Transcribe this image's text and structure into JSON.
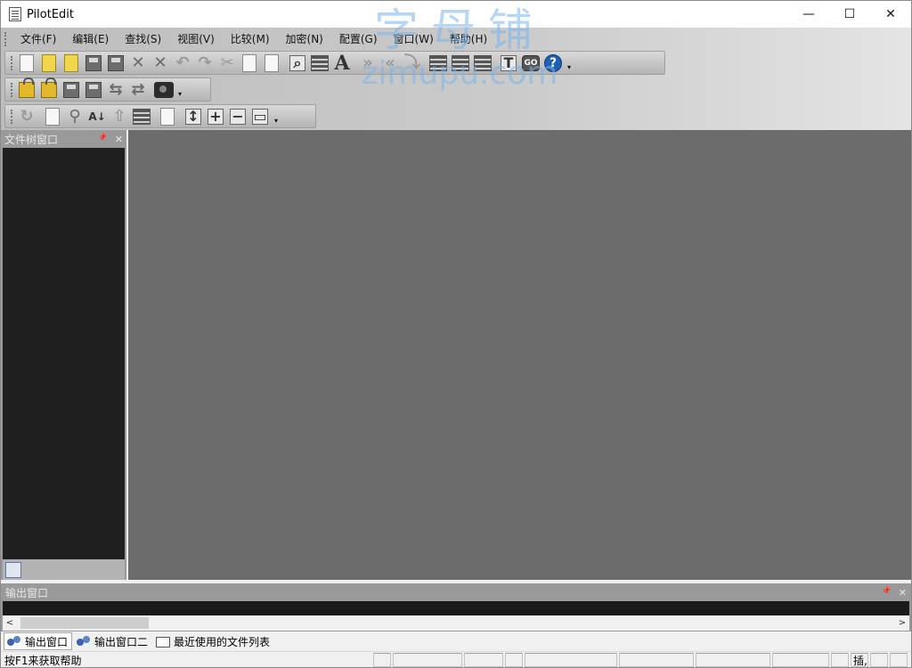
{
  "window": {
    "title": "PilotEdit",
    "controls": {
      "minimize": "—",
      "maximize": "☐",
      "close": "✕"
    }
  },
  "watermark": {
    "cn": "字母铺",
    "en": "zimupu.com"
  },
  "menu": [
    "文件(F)",
    "编辑(E)",
    "查找(S)",
    "视图(V)",
    "比较(M)",
    "加密(N)",
    "配置(G)",
    "窗口(W)",
    "帮助(H)"
  ],
  "toolbar_icons": {
    "row1": [
      "new-file-icon",
      "open-file-icon",
      "open-file-alt-icon",
      "save-icon",
      "save-all-icon",
      "close-icon",
      "close-all-icon",
      "undo-icon",
      "redo-icon",
      "cut-icon",
      "copy-icon",
      "paste-icon",
      "find-icon",
      "format-icon",
      "font-icon",
      "next-bookmark-icon",
      "prev-bookmark-icon",
      "indent-icon",
      "column-mode-icon",
      "column-mode-2-icon",
      "column-mode-3-icon",
      "run-script-icon",
      "go-icon",
      "help-icon"
    ],
    "row2": [
      "encrypt-icon",
      "decrypt-icon",
      "save-encrypted-icon",
      "save-as-encrypted-icon",
      "compare-icon",
      "compare-alt-icon",
      "lock-camera-icon"
    ],
    "row3": [
      "tool-refresh-icon",
      "tool-new-icon",
      "tool-search-icon",
      "sort-az-icon",
      "move-up-icon",
      "list-icon",
      "zoom-page-icon",
      "expand-icon",
      "add-icon",
      "remove-icon",
      "window-icon"
    ]
  },
  "left_panel": {
    "title": "文件树窗口",
    "pin": "📌",
    "close": "✕"
  },
  "output_panel": {
    "title": "输出窗口",
    "pin": "📌",
    "close": "✕",
    "scroll_left": "<",
    "scroll_right": ">"
  },
  "output_tabs": [
    {
      "label": "输出窗口",
      "active": true
    },
    {
      "label": "输出窗口二",
      "active": false
    },
    {
      "label": "最近使用的文件列表",
      "active": false
    }
  ],
  "status": {
    "help_text": "按F1来获取帮助",
    "insert_mode": "插,"
  },
  "toolbar_more": "▾"
}
